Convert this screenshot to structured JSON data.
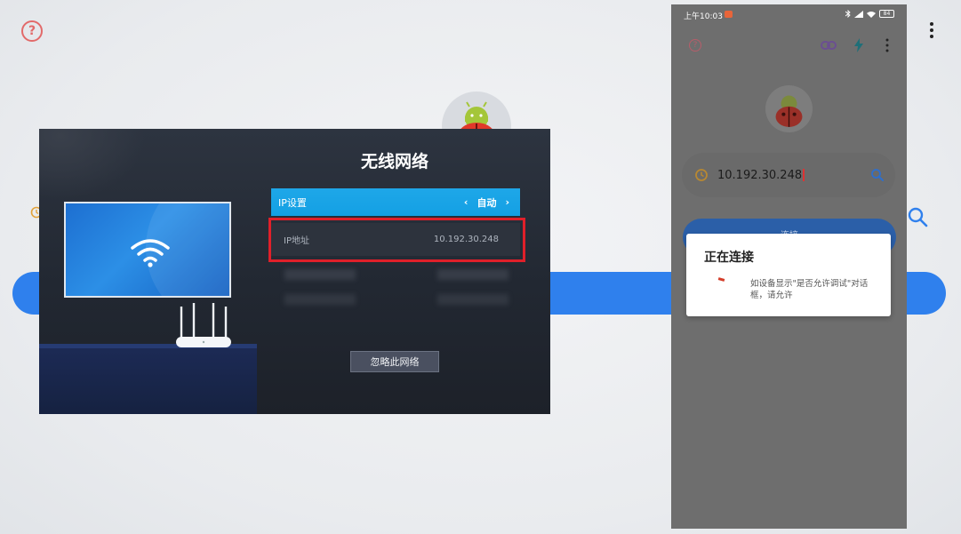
{
  "desktop": {
    "help_glyph": "?"
  },
  "tv": {
    "title": "无线网络",
    "ip_settings_label": "IP设置",
    "ip_settings_value": "自动",
    "prev_arrow": "‹",
    "next_arrow": "›",
    "ip_address_label": "IP地址",
    "ip_address_value": "10.192.30.248",
    "ignore_button": "忽略此网络"
  },
  "phone": {
    "status_time": "上午10:03",
    "battery": "84",
    "help_glyph": "?",
    "input_value": "10.192.30.248",
    "connect_button": "连接",
    "dialog": {
      "title": "正在连接",
      "message": "如设备显示\"是否允许调试\"对话框，请允许"
    }
  },
  "colors": {
    "accent_blue": "#2f80ed",
    "tv_highlight": "#1ea7e8",
    "red_highlight": "#e0202a",
    "phone_overlay": "#6e6e6e"
  },
  "icons": [
    "help-icon",
    "history-icon",
    "search-icon",
    "wifi-icon",
    "router-icon",
    "link-icon",
    "bolt-icon",
    "more-vert-icon",
    "bug-avatar-icon"
  ]
}
